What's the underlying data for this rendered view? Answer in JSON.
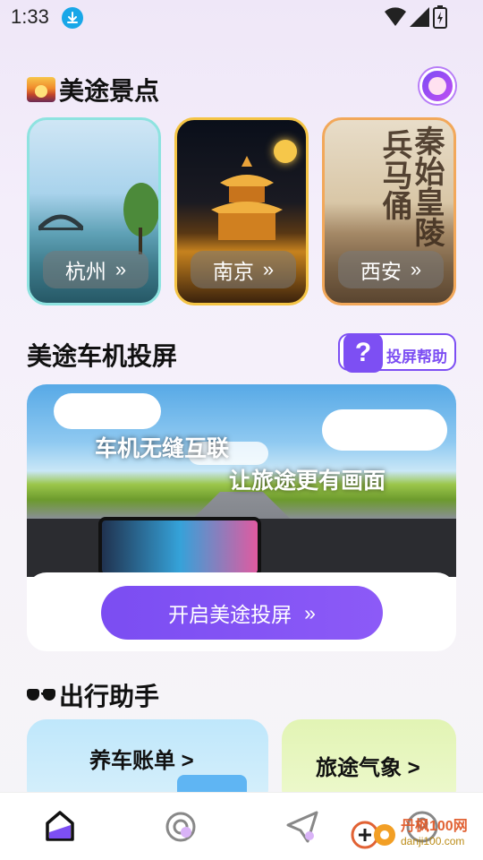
{
  "status_bar": {
    "time": "1:33"
  },
  "scenic": {
    "title": "美途景点",
    "cards": [
      {
        "label": "杭州",
        "chevron": "»"
      },
      {
        "label": "南京",
        "chevron": "»"
      },
      {
        "label": "西安",
        "chevron": "»"
      }
    ],
    "xian_image_text": [
      "秦始皇陵",
      "兵马俑"
    ]
  },
  "cast": {
    "title": "美途车机投屏",
    "help_icon": "?",
    "help_label": "投屏帮助",
    "banner_line1": "车机无缝互联",
    "banner_line2": "让旅途更有画面",
    "button_label": "开启美途投屏",
    "button_chevron": "»"
  },
  "assistant": {
    "title": "出行助手",
    "cards": [
      {
        "label": "养车账单 >"
      },
      {
        "label": "旅途气象 >"
      }
    ]
  },
  "watermark": {
    "text": "丹枫100网",
    "sub": "danji100.com"
  },
  "nav": {
    "items": [
      {
        "icon": "home-icon"
      },
      {
        "icon": "explore-icon"
      },
      {
        "icon": "send-icon"
      },
      {
        "icon": "profile-icon"
      }
    ]
  },
  "colors": {
    "accent": "#7d4ff3",
    "button": "#8056f4"
  }
}
